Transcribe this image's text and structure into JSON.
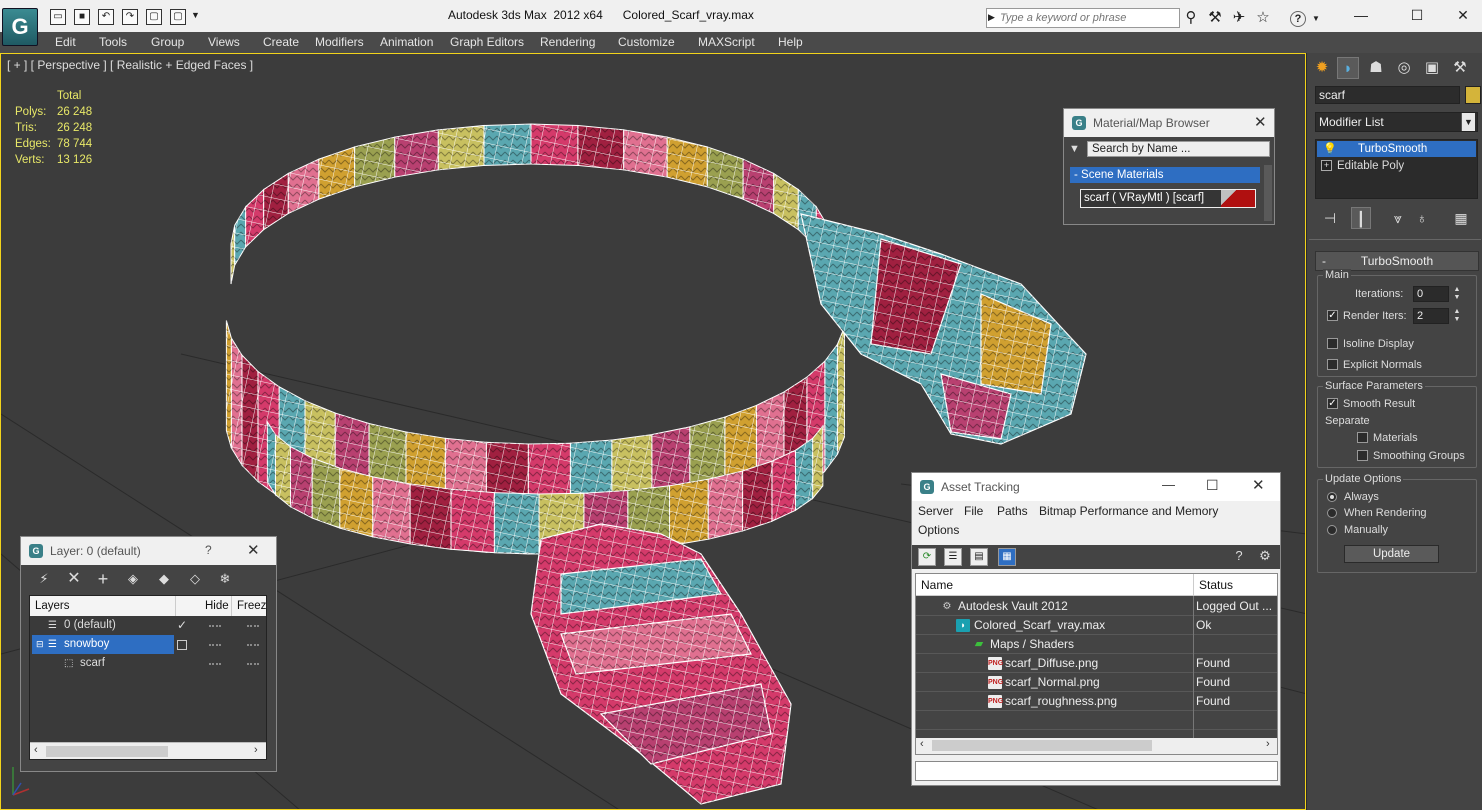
{
  "app": {
    "logo_letter": "G",
    "title": "Autodesk 3ds Max  2012 x64      Colored_Scarf_vray.max",
    "search_placeholder": "Type a keyword or phrase",
    "help_label": "?"
  },
  "menu": [
    "Edit",
    "Tools",
    "Group",
    "Views",
    "Create",
    "Modifiers",
    "Animation",
    "Graph Editors",
    "Rendering",
    "Customize",
    "MAXScript",
    "Help"
  ],
  "viewport": {
    "label": "[ + ] [ Perspective ] [ Realistic + Edged Faces ]",
    "stats_header": "Total",
    "stats": [
      {
        "key": "Polys:",
        "value": "26 248"
      },
      {
        "key": "Tris:",
        "value": "26 248"
      },
      {
        "key": "Edges:",
        "value": "78 744"
      },
      {
        "key": "Verts:",
        "value": "13 126"
      }
    ],
    "stripe_colors": [
      "#c8c060",
      "#5aa7b0",
      "#d43a6a",
      "#a02040",
      "#e07090",
      "#d0a030",
      "#9aa050",
      "#b84070"
    ]
  },
  "command_panel": {
    "object_name": "scarf",
    "modifier_list": "Modifier List",
    "stack": [
      "TurboSmooth",
      "Editable Poly"
    ],
    "rollout_title": "TurboSmooth",
    "main_label": "Main",
    "iterations_label": "Iterations:",
    "iterations_value": "0",
    "render_iters_label": "Render Iters:",
    "render_iters_value": "2",
    "isoline_label": "Isoline Display",
    "explicit_normals_label": "Explicit Normals",
    "surface_params_label": "Surface Parameters",
    "smooth_result_label": "Smooth Result",
    "separate_label": "Separate",
    "materials_label": "Materials",
    "smoothing_groups_label": "Smoothing Groups",
    "update_options_label": "Update Options",
    "always_label": "Always",
    "when_rendering_label": "When Rendering",
    "manually_label": "Manually",
    "update_button": "Update",
    "minus": "-"
  },
  "material_browser": {
    "title": "Material/Map Browser",
    "search_placeholder": "Search by Name ...",
    "category": "- Scene Materials",
    "item": "scarf  ( VRayMtl )  [scarf]"
  },
  "layers": {
    "title": "Layer: 0 (default)",
    "help": "?",
    "columns": [
      "Layers",
      "Hide",
      "Freez"
    ],
    "rows": [
      {
        "name": "0 (default)",
        "indent": 0
      },
      {
        "name": "snowboy",
        "indent": 0
      },
      {
        "name": "scarf",
        "indent": 1
      }
    ]
  },
  "asset_tracking": {
    "title": "Asset Tracking",
    "menu": [
      "Server",
      "File",
      "Paths",
      "Bitmap Performance and Memory",
      "Options"
    ],
    "columns": [
      "Name",
      "Status"
    ],
    "rows": [
      {
        "name": "Autodesk Vault 2012",
        "status": "Logged Out ...",
        "indent": 0,
        "icon": "vault-icon"
      },
      {
        "name": "Colored_Scarf_vray.max",
        "status": "Ok",
        "indent": 1,
        "icon": "max-file-icon"
      },
      {
        "name": "Maps / Shaders",
        "status": "",
        "indent": 2,
        "icon": "maps-folder-icon"
      },
      {
        "name": "scarf_Diffuse.png",
        "status": "Found",
        "indent": 3,
        "icon": "png-icon"
      },
      {
        "name": "scarf_Normal.png",
        "status": "Found",
        "indent": 3,
        "icon": "png-icon"
      },
      {
        "name": "scarf_roughness.png",
        "status": "Found",
        "indent": 3,
        "icon": "png-icon"
      }
    ]
  }
}
